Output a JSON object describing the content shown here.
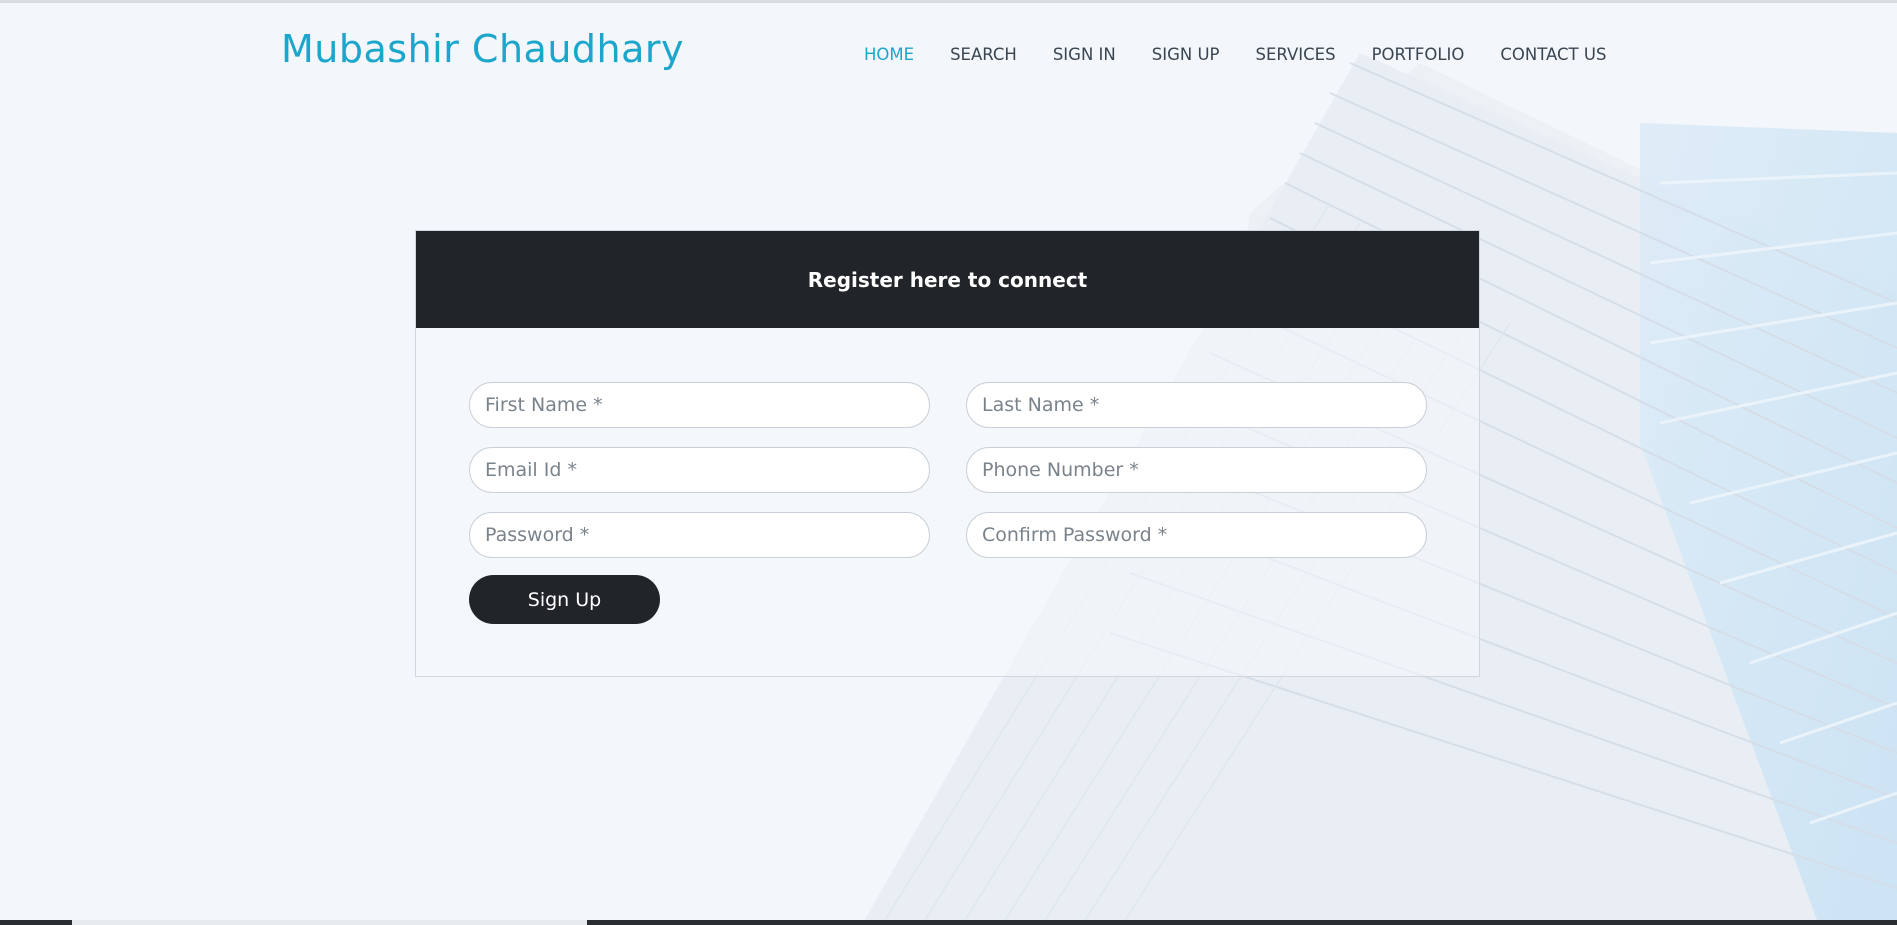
{
  "header": {
    "brand": "Mubashir Chaudhary",
    "nav": [
      {
        "label": "HOME",
        "active": true
      },
      {
        "label": "SEARCH",
        "active": false
      },
      {
        "label": "SIGN IN",
        "active": false
      },
      {
        "label": "SIGN UP",
        "active": false
      },
      {
        "label": "SERVICES",
        "active": false
      },
      {
        "label": "PORTFOLIO",
        "active": false
      },
      {
        "label": "CONTACT US",
        "active": false
      }
    ]
  },
  "form": {
    "title": "Register here to connect",
    "first_name_placeholder": "First Name *",
    "last_name_placeholder": "Last Name *",
    "email_placeholder": "Email Id *",
    "phone_placeholder": "Phone Number *",
    "password_placeholder": "Password *",
    "confirm_password_placeholder": "Confirm Password *",
    "submit_label": "Sign Up"
  },
  "colors": {
    "accent": "#1ba6cc",
    "dark": "#212529",
    "background": "#f3f6fa"
  }
}
